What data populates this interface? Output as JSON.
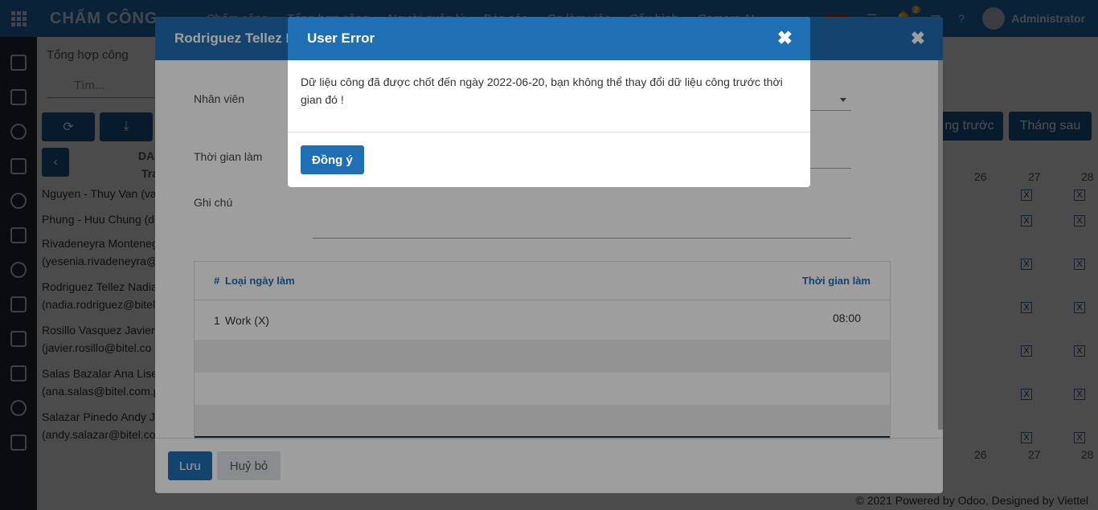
{
  "topbar": {
    "app_title": "CHẤM CÔNG",
    "menu": [
      "Chấm công",
      "Tổng hợp công",
      "Người quản lý",
      "Báo cáo",
      "Ca làm việc",
      "Cấu hình",
      "Camera AI"
    ],
    "notifications_count": "2",
    "user_name": "Administrator"
  },
  "background": {
    "breadcrumb": "Tổng hợp công",
    "search_placeholder": "Tìm...",
    "prev_month": "ng trước",
    "next_month": "Tháng sau",
    "col_header_a": "DA",
    "col_header_b": "Tra",
    "nav_prev": "‹",
    "days": [
      "26",
      "27",
      "28"
    ],
    "rows": [
      {
        "line1": "Nguyen - Thuy Van (van",
        "line2": ""
      },
      {
        "line1": "Phung - Huu Chung (du",
        "line2": ""
      },
      {
        "line1": "Rivadeneyra Monteneg",
        "line2": "(yesenia.rivadeneyra@"
      },
      {
        "line1": "Rodriguez Tellez Nadia",
        "line2": "(nadia.rodriguez@bitel"
      },
      {
        "line1": "Rosillo Vasquez Javier",
        "line2": "(javier.rosillo@bitel.co"
      },
      {
        "line1": "Salas Bazalar Ana Lise",
        "line2": "(ana.salas@bitel.com.p"
      },
      {
        "line1": "Salazar Pinedo Andy Je",
        "line2": "(andy.salazar@bitel.co"
      }
    ],
    "cell_mark": "X",
    "footer": "© 2021 Powered by Odoo, Designed by Viettel"
  },
  "form_dialog": {
    "title": "Rodriguez Tellez N",
    "close": "✖",
    "labels": {
      "employee": "Nhân viên",
      "work_time": "Thời gian làm",
      "note": "Ghi chú"
    },
    "table": {
      "col_num": "#",
      "col_type": "Loại ngày làm",
      "col_time": "Thời gian làm",
      "rows": [
        {
          "num": "1",
          "type": "Work (X)",
          "time": "08:00"
        }
      ]
    },
    "save_label": "Lưu",
    "cancel_label": "Huỷ bỏ"
  },
  "error_dialog": {
    "title": "User Error",
    "close": "✖",
    "message": "Dữ liệu công đã được chốt đến ngày 2022-06-20, bạn không thể thay đổi dữ liệu công trước thời gian đó !",
    "ok_label": "Đồng ý"
  },
  "colors": {
    "primary": "#1f6fb5",
    "sidebar": "#1e2b37"
  }
}
